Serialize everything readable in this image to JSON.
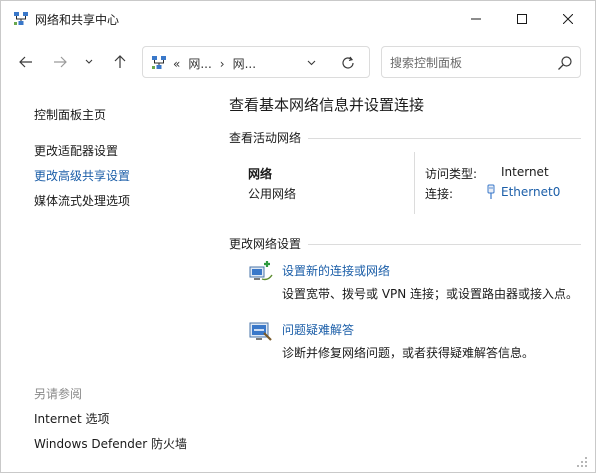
{
  "window": {
    "title": "网络和共享中心",
    "icon": "network-center-icon"
  },
  "titlebar_buttons": [
    "minimize-icon",
    "maximize-icon",
    "close-icon"
  ],
  "nav": {
    "address_crumbs": [
      "«",
      "网...",
      "›",
      "网..."
    ],
    "search_placeholder": "搜索控制面板"
  },
  "sidebar": {
    "items": [
      {
        "label": "控制面板主页"
      },
      {
        "label": "更改适配器设置"
      },
      {
        "label": "更改高级共享设置"
      },
      {
        "label": "媒体流式处理选项"
      }
    ],
    "see_also_title": "另请参阅",
    "see_also": [
      {
        "label": "Internet 选项"
      },
      {
        "label": "Windows Defender 防火墙"
      }
    ]
  },
  "main": {
    "title": "查看基本网络信息并设置连接",
    "active_networks_label": "查看活动网络",
    "network": {
      "name": "网络",
      "type": "公用网络",
      "access_type_label": "访问类型:",
      "access_type_value": "Internet",
      "connections_label": "连接:",
      "connection_value": "Ethernet0"
    },
    "change_settings_label": "更改网络设置",
    "tasks": [
      {
        "link": "设置新的连接或网络",
        "desc": "设置宽带、拨号或 VPN 连接；或设置路由器或接入点。",
        "icon": "new-connection-icon"
      },
      {
        "link": "问题疑难解答",
        "desc": "诊断并修复网络问题，或者获得疑难解答信息。",
        "icon": "troubleshoot-icon"
      }
    ]
  },
  "colors": {
    "link": "#1b5ea8",
    "text": "#1a1a1a",
    "muted": "#8a8a8a"
  }
}
